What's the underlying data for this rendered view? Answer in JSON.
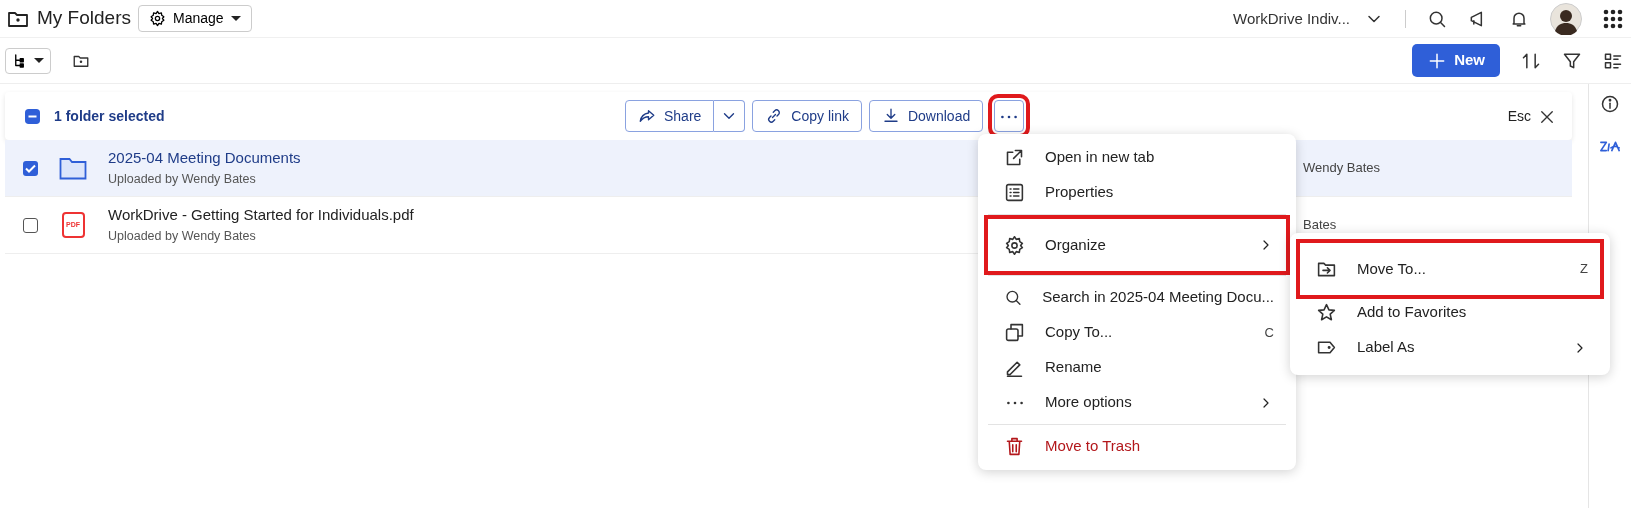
{
  "header": {
    "title": "My Folders",
    "manage_button": "Manage",
    "workspace": "WorkDrive Indiv..."
  },
  "toolbar": {
    "new_button": "New"
  },
  "selection_bar": {
    "select_all_checked": true,
    "select_all_indeterminate": true,
    "label": "1 folder selected",
    "actions": [
      {
        "label": "Share",
        "kind": "share"
      },
      {
        "label": "Copy link",
        "kind": "link"
      },
      {
        "label": "Download",
        "kind": "download"
      }
    ],
    "more_highlighted": true,
    "esc": "Esc"
  },
  "files": [
    {
      "name": "2025-04 Meeting Documents",
      "subtitle": "Uploaded by Wendy Bates",
      "kind": "folder",
      "selected": true,
      "owner": "Wendy Bates"
    },
    {
      "name": "WorkDrive - Getting Started for Individuals.pdf",
      "subtitle": "Uploaded by Wendy Bates",
      "kind": "pdf",
      "icon_label": "PDF",
      "selected": false,
      "owner": "Bates"
    }
  ],
  "context_menu": {
    "groups": [
      [
        {
          "label": "Open in new tab"
        },
        {
          "label": "Properties"
        }
      ],
      [
        {
          "label": "Organize",
          "submenu": true,
          "highlighted": true
        }
      ],
      [
        {
          "label": "Search in 2025-04 Meeting Docu..."
        },
        {
          "label": "Copy To...",
          "shortcut": "C"
        },
        {
          "label": "Rename"
        },
        {
          "label": "More options",
          "submenu": true
        }
      ],
      [
        {
          "label": "Move to Trash",
          "danger": true
        }
      ]
    ]
  },
  "submenu": {
    "items": [
      {
        "label": "Move To...",
        "shortcut": "Z",
        "highlighted": true
      },
      {
        "label": "Add to Favorites"
      },
      {
        "label": "Label As",
        "submenu": true
      }
    ]
  }
}
